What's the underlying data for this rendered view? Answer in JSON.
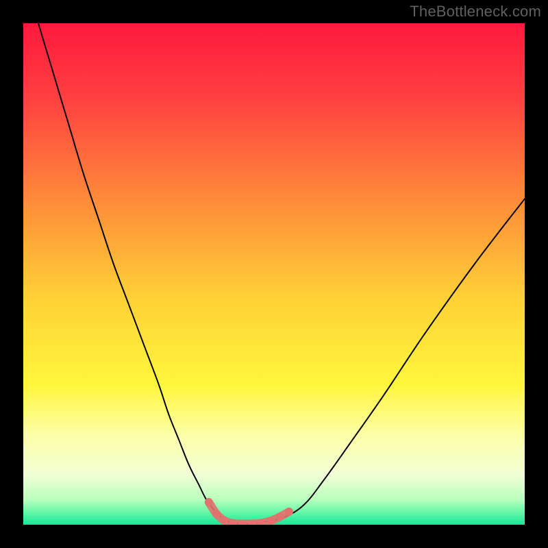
{
  "watermark": "TheBottleneck.com",
  "chart_data": {
    "type": "line",
    "title": "",
    "xlabel": "",
    "ylabel": "",
    "xlim": [
      0,
      100
    ],
    "ylim": [
      0,
      100
    ],
    "grid": false,
    "legend": false,
    "background": {
      "type": "vertical-gradient",
      "stops": [
        {
          "offset": 0.0,
          "color": "#ff193d"
        },
        {
          "offset": 0.15,
          "color": "#ff4040"
        },
        {
          "offset": 0.35,
          "color": "#ff8a3a"
        },
        {
          "offset": 0.55,
          "color": "#ffd236"
        },
        {
          "offset": 0.72,
          "color": "#fff63b"
        },
        {
          "offset": 0.82,
          "color": "#fdffa6"
        },
        {
          "offset": 0.9,
          "color": "#f2ffd6"
        },
        {
          "offset": 0.95,
          "color": "#b9ffbe"
        },
        {
          "offset": 0.975,
          "color": "#66f7a8"
        },
        {
          "offset": 1.0,
          "color": "#14e897"
        }
      ]
    },
    "series": [
      {
        "name": "bottleneck-curve",
        "color": "#000000",
        "stroke_width": 2,
        "x": [
          3,
          6,
          9,
          12,
          15,
          18,
          21,
          24,
          27,
          29,
          31,
          33,
          35,
          36.5,
          38,
          39.5,
          41,
          43,
          45,
          48,
          52,
          56,
          60,
          65,
          72,
          80,
          90,
          100
        ],
        "y": [
          100,
          90,
          80,
          70,
          61,
          52,
          44,
          36,
          28,
          22,
          17,
          12,
          8,
          5,
          3,
          1.5,
          0.6,
          0.2,
          0.2,
          0.5,
          1.5,
          4,
          9,
          16,
          26,
          38,
          52,
          65
        ]
      }
    ],
    "markers": {
      "name": "trough-markers",
      "color": "#e2726d",
      "radius": 6,
      "points": [
        {
          "x": 37.0,
          "y": 4.5
        },
        {
          "x": 38.5,
          "y": 2.2
        },
        {
          "x": 40.0,
          "y": 0.9
        },
        {
          "x": 41.8,
          "y": 0.3
        },
        {
          "x": 43.7,
          "y": 0.2
        },
        {
          "x": 45.6,
          "y": 0.2
        },
        {
          "x": 47.5,
          "y": 0.35
        },
        {
          "x": 49.4,
          "y": 0.8
        },
        {
          "x": 51.2,
          "y": 1.6
        },
        {
          "x": 53.0,
          "y": 2.6
        }
      ]
    }
  }
}
